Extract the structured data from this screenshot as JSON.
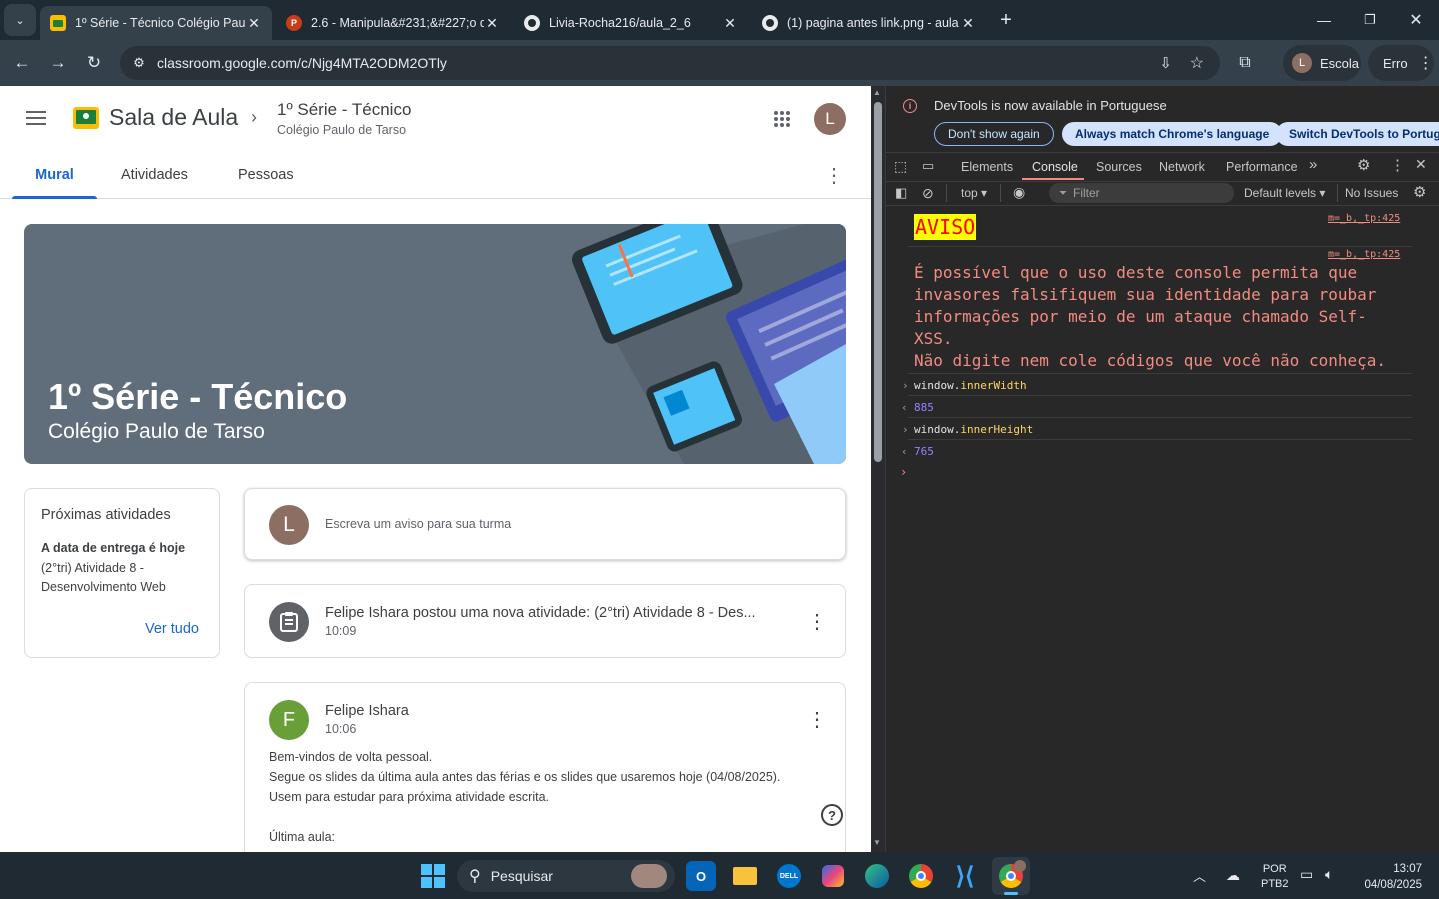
{
  "browser": {
    "tabs": [
      {
        "title": "1º Série - Técnico Colégio Paulo",
        "favicon": "classroom-icon",
        "active": true
      },
      {
        "title": "2.6 - Manipula&#231;&#227;o d",
        "favicon": "powerpoint-icon",
        "active": false
      },
      {
        "title": "Livia-Rocha216/aula_2_6",
        "favicon": "github-icon",
        "active": false
      },
      {
        "title": "(1) pagina antes link.png - aula",
        "favicon": "github-icon",
        "active": false
      }
    ],
    "new_tab": "+",
    "url": "classroom.google.com/c/Njg4MTA2ODM2OTly",
    "profile_label": "Escola",
    "profile_initial": "L",
    "error_label": "Erro"
  },
  "classroom": {
    "app_name": "Sala de Aula",
    "class_title": "1º Série - Técnico",
    "class_subtitle": "Colégio Paulo de Tarso",
    "user_initial": "L",
    "tabs": [
      "Mural",
      "Atividades",
      "Pessoas"
    ],
    "active_tab": "Mural",
    "banner": {
      "title": "1º Série - Técnico",
      "subtitle": "Colégio Paulo de Tarso"
    },
    "upcoming": {
      "heading": "Próximas atividades",
      "due_label": "A data de entrega é hoje",
      "item": "(2°tri) Atividade 8 - Desenvolvimento Web",
      "view_all": "Ver tudo"
    },
    "announce_placeholder": "Escreva um aviso para sua turma",
    "posts": [
      {
        "text": "Felipe Ishara postou uma nova atividade: (2°tri) Atividade 8 - Des...",
        "time": "10:09"
      },
      {
        "author": "Felipe Ishara",
        "author_initial": "F",
        "time": "10:06",
        "lines": [
          "Bem-vindos de volta pessoal.",
          "Segue os slides da última aula antes das férias e os slides que usaremos hoje (04/08/2025).",
          "Usem para estudar para próxima atividade escrita.",
          "",
          "Última aula:"
        ]
      }
    ],
    "help": "?"
  },
  "devtools": {
    "notice": "DevTools is now available in Portuguese",
    "buttons": [
      "Don't show again",
      "Always match Chrome's language",
      "Switch DevTools to Portugu"
    ],
    "tabs": [
      "Elements",
      "Console",
      "Sources",
      "Network",
      "Performance"
    ],
    "active_tab": "Console",
    "context": "top",
    "filter_placeholder": "Filter",
    "levels": "Default levels",
    "issues": "No Issues",
    "console": {
      "warning_title": "AVISO",
      "source1": "m=_b,_tp:425",
      "source2": "m=_b,_tp:425",
      "warning_lines": [
        "É possível que o uso deste console permita que",
        "invasores falsifiquem sua identidade para roubar",
        "informações por meio de um ataque chamado Self-",
        "XSS.",
        "Não digite nem cole códigos que você não conheça."
      ],
      "entries": [
        {
          "obj": "window.",
          "prop": "innerWidth",
          "result": "885"
        },
        {
          "obj": "window.",
          "prop": "innerHeight",
          "result": "765"
        }
      ]
    }
  },
  "taskbar": {
    "search": "Pesquisar",
    "lang_top": "POR",
    "lang_bottom": "PTB2",
    "time": "13:07",
    "date": "04/08/2025"
  },
  "colors": {
    "classroom_blue": "#1967d2",
    "console_warning_bg": "#ffff00",
    "console_warning_text": "#ff0000"
  }
}
